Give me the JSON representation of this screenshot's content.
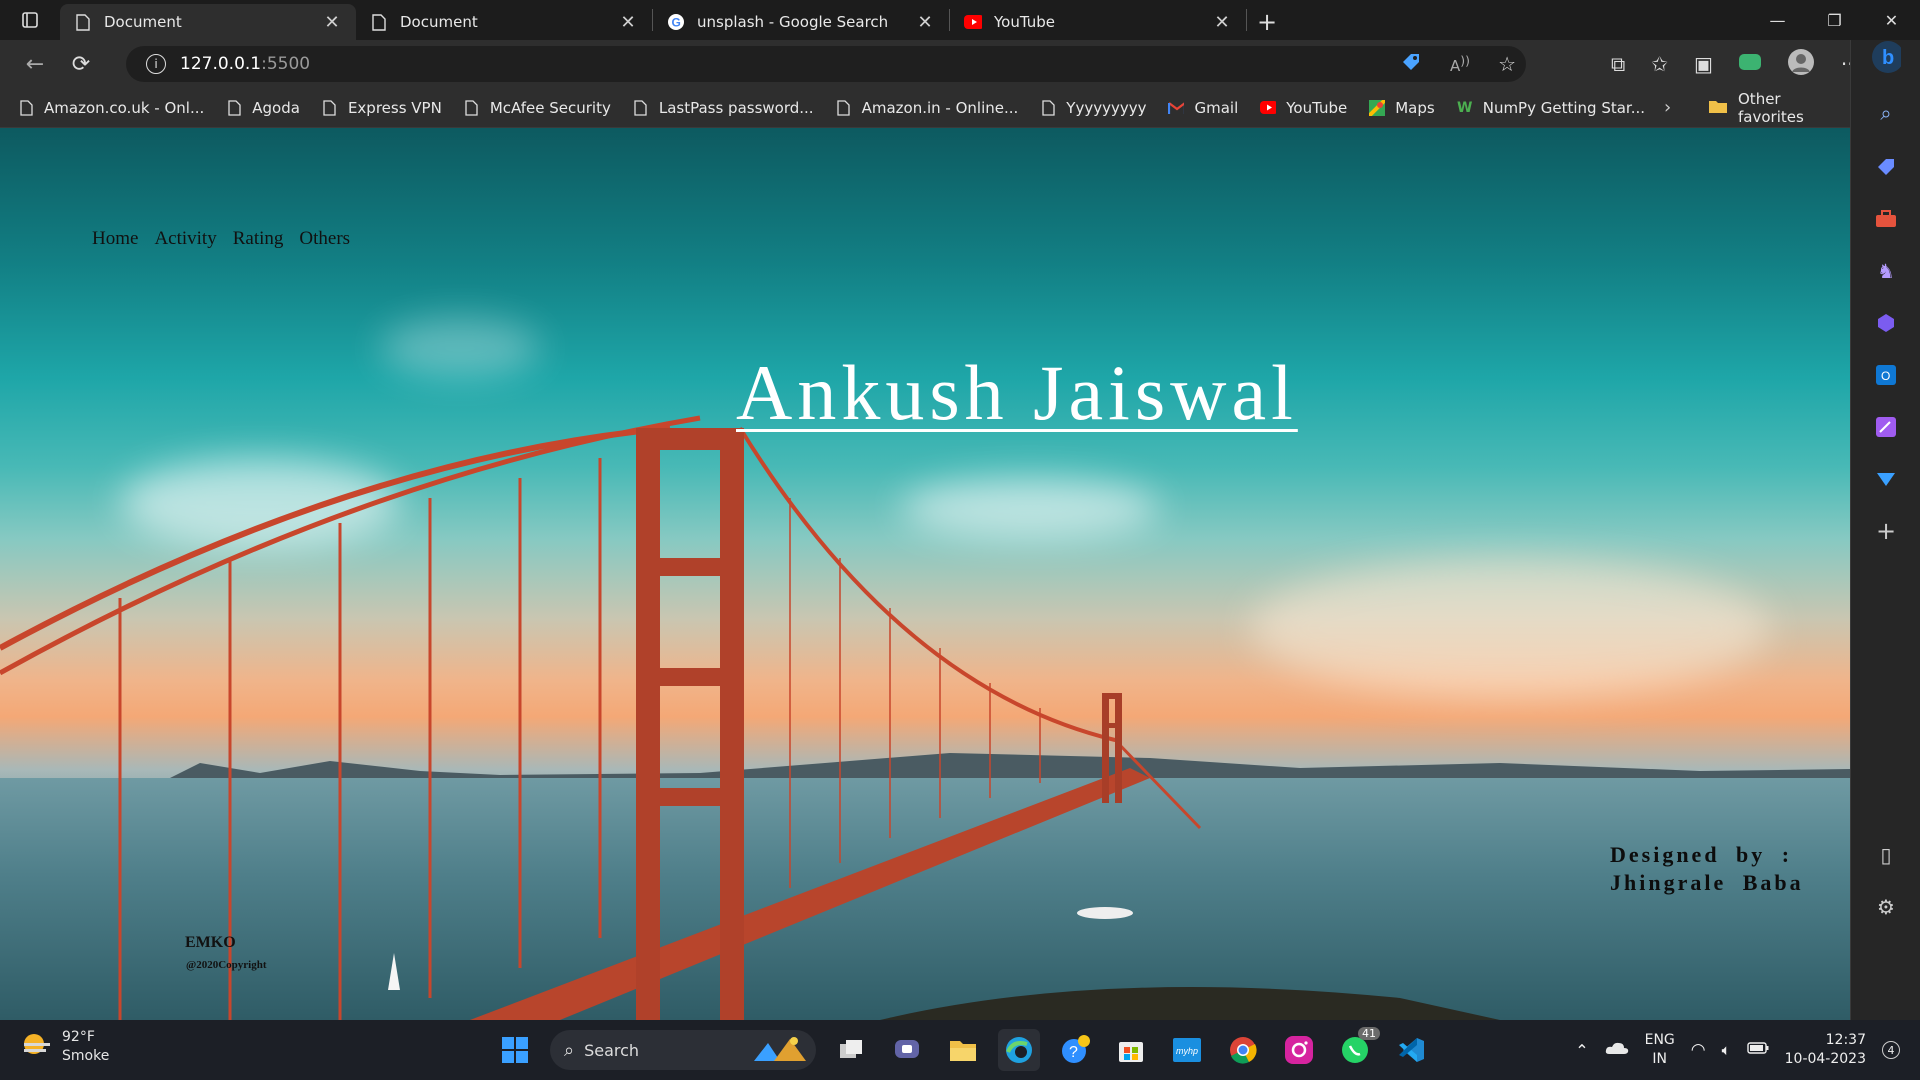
{
  "browser": {
    "tabs": [
      {
        "title": "Document",
        "icon": "page-icon",
        "active": true
      },
      {
        "title": "Document",
        "icon": "page-icon",
        "active": false
      },
      {
        "title": "unsplash - Google Search",
        "icon": "google-icon",
        "active": false
      },
      {
        "title": "YouTube",
        "icon": "youtube-icon",
        "active": false
      }
    ],
    "address": {
      "host": "127.0.0.1",
      "port": ":5500"
    },
    "bookmarks": [
      {
        "label": "Amazon.co.uk - Onl...",
        "icon": "page-icon"
      },
      {
        "label": "Agoda",
        "icon": "page-icon"
      },
      {
        "label": "Express VPN",
        "icon": "page-icon"
      },
      {
        "label": "McAfee Security",
        "icon": "page-icon"
      },
      {
        "label": "LastPass password...",
        "icon": "page-icon"
      },
      {
        "label": "Amazon.in - Online...",
        "icon": "page-icon"
      },
      {
        "label": "Yyyyyyyyy",
        "icon": "page-icon"
      },
      {
        "label": "Gmail",
        "icon": "gmail-icon"
      },
      {
        "label": "YouTube",
        "icon": "youtube-icon"
      },
      {
        "label": "Maps",
        "icon": "maps-icon"
      },
      {
        "label": "NumPy Getting Star...",
        "icon": "numpy-icon"
      }
    ],
    "other_favorites": "Other favorites"
  },
  "site": {
    "nav": [
      "Home",
      "Activity",
      "Rating",
      "Others"
    ],
    "hero_title": "Ankush Jaiswal",
    "designed_line1": "Designed by :",
    "designed_line2": "Jhingrale Baba",
    "brand": "EMKO",
    "copyright": "@2020Copyright"
  },
  "taskbar": {
    "temperature": "92°F",
    "condition": "Smoke",
    "search_label": "Search",
    "whatsapp_badge": "41",
    "lang_top": "ENG",
    "lang_bottom": "IN",
    "time": "12:37",
    "date": "10-04-2023",
    "notification_count": "4"
  },
  "colors": {
    "accent": "#0a84ff",
    "youtube": "#ff0000",
    "sky_top": "#0d5a60",
    "sunset": "#f4a876",
    "bridge": "#c8462c"
  }
}
